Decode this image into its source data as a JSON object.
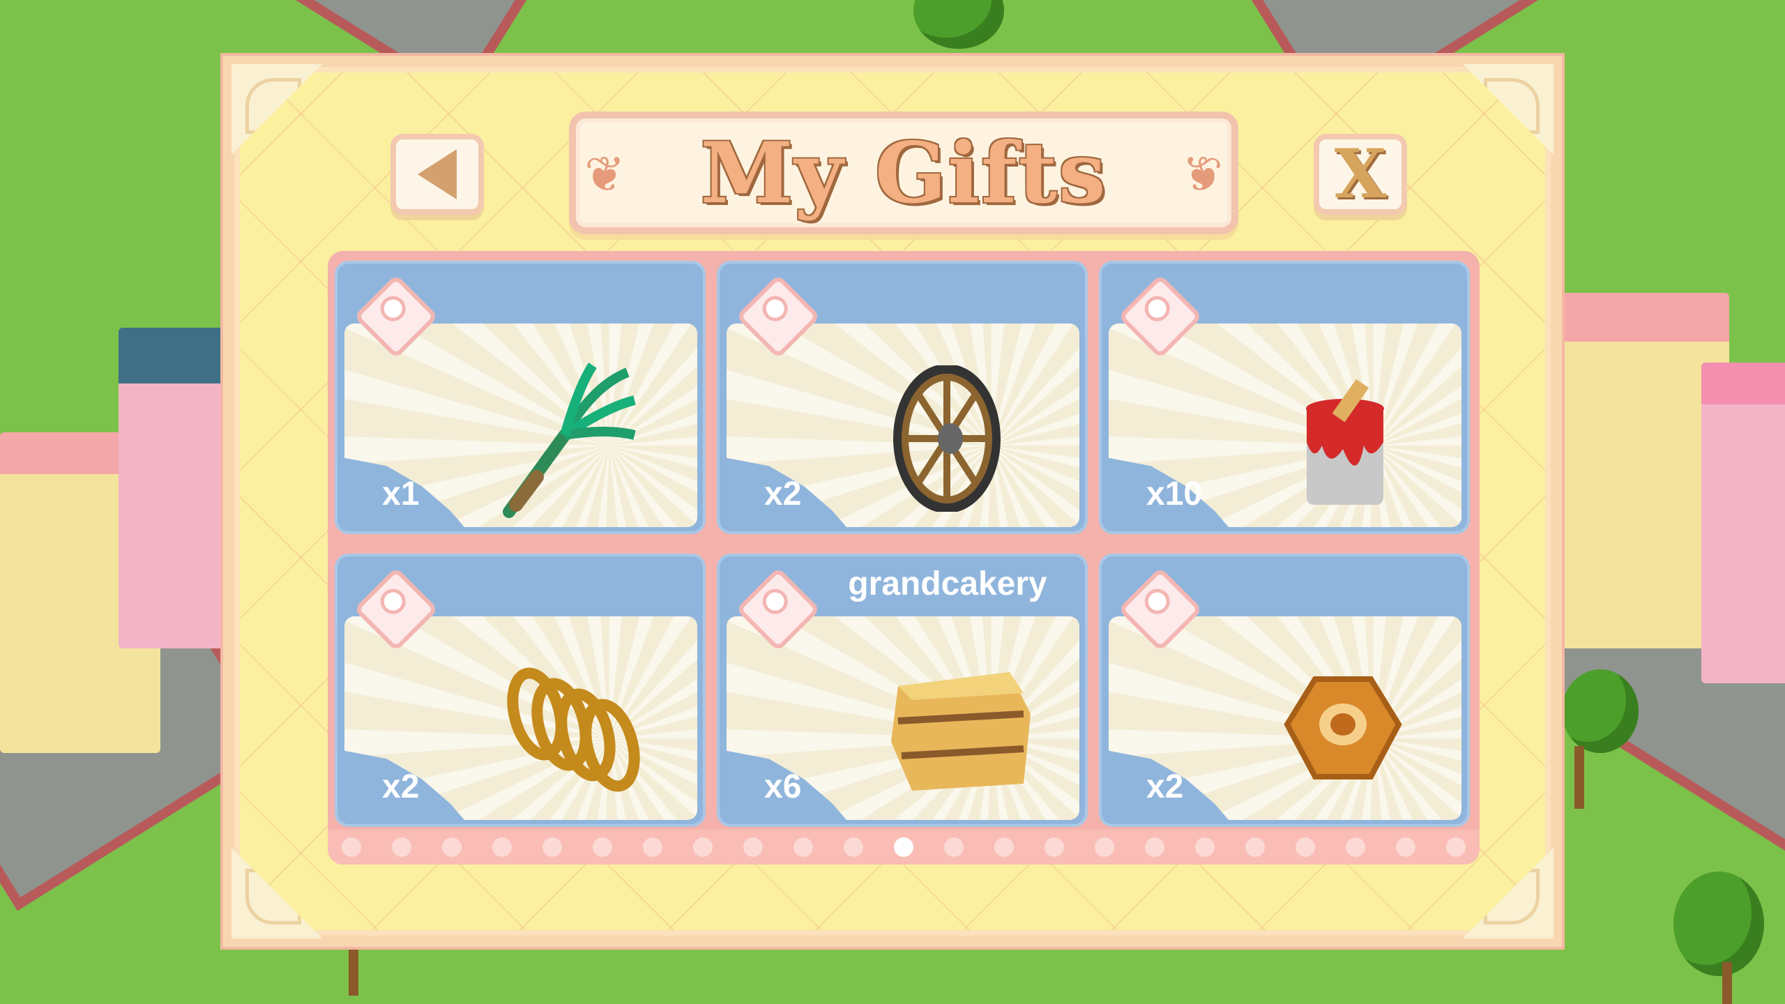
{
  "modal": {
    "title": "My Gifts",
    "back_icon": "back-arrow-icon",
    "close_label": "X"
  },
  "gifts": [
    {
      "quantity": "x1",
      "sender": "",
      "item_icon": "green-onion-icon"
    },
    {
      "quantity": "x2",
      "sender": "",
      "item_icon": "wagon-wheel-icon"
    },
    {
      "quantity": "x10",
      "sender": "",
      "item_icon": "paint-bucket-icon"
    },
    {
      "quantity": "x2",
      "sender": "",
      "item_icon": "coil-spring-icon"
    },
    {
      "quantity": "x6",
      "sender": "grandcakery",
      "item_icon": "hay-bale-icon"
    },
    {
      "quantity": "x2",
      "sender": "",
      "item_icon": "wooden-nut-icon"
    }
  ],
  "pagination": {
    "total": 23,
    "current": 12
  },
  "colors": {
    "panel": "#fbf09f",
    "card": "#90b5dc",
    "title": "#f4b083",
    "grid_frame": "#f5b2ac"
  }
}
